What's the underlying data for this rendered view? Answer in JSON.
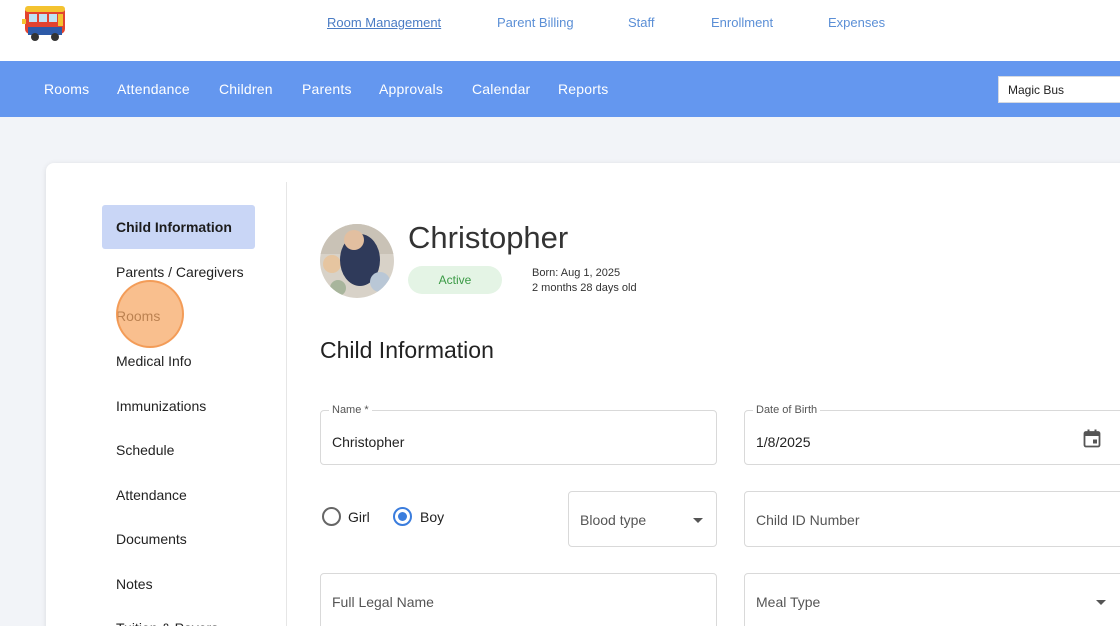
{
  "top_links": [
    {
      "label": "Room Management",
      "active": true
    },
    {
      "label": "Parent Billing",
      "active": false
    },
    {
      "label": "Staff",
      "active": false
    },
    {
      "label": "Enrollment",
      "active": false
    },
    {
      "label": "Expenses",
      "active": false
    }
  ],
  "nav": {
    "items": [
      "Rooms",
      "Attendance",
      "Children",
      "Parents",
      "Approvals",
      "Calendar",
      "Reports"
    ],
    "school_select_value": "Magic Bus"
  },
  "sidebar": {
    "items": [
      {
        "label": "Child Information",
        "active": true
      },
      {
        "label": "Parents / Caregivers",
        "active": false
      },
      {
        "label": "Rooms",
        "active": false
      },
      {
        "label": "Medical Info",
        "active": false
      },
      {
        "label": "Immunizations",
        "active": false
      },
      {
        "label": "Schedule",
        "active": false
      },
      {
        "label": "Attendance",
        "active": false
      },
      {
        "label": "Documents",
        "active": false
      },
      {
        "label": "Notes",
        "active": false
      },
      {
        "label": "Tuition & Payers",
        "active": false
      }
    ]
  },
  "child": {
    "name": "Christopher",
    "status": "Active",
    "born": "Born: Aug 1, 2025",
    "age": "2 months 28 days old"
  },
  "section_title": "Child Information",
  "form": {
    "name_label": "Name *",
    "name_value": "Christopher",
    "dob_label": "Date of Birth",
    "dob_value": "1/8/2025",
    "gender_options": [
      {
        "label": "Girl",
        "checked": false
      },
      {
        "label": "Boy",
        "checked": true
      }
    ],
    "blood_type_placeholder": "Blood type",
    "child_id_placeholder": "Child ID Number",
    "full_legal_name_placeholder": "Full Legal Name",
    "meal_type_placeholder": "Meal Type"
  },
  "colors": {
    "nav_bg": "#6497ef",
    "active_sidebar_bg": "#c9d6f6",
    "status_green": "#3a9a45",
    "radio_blue": "#3b7ddd"
  }
}
